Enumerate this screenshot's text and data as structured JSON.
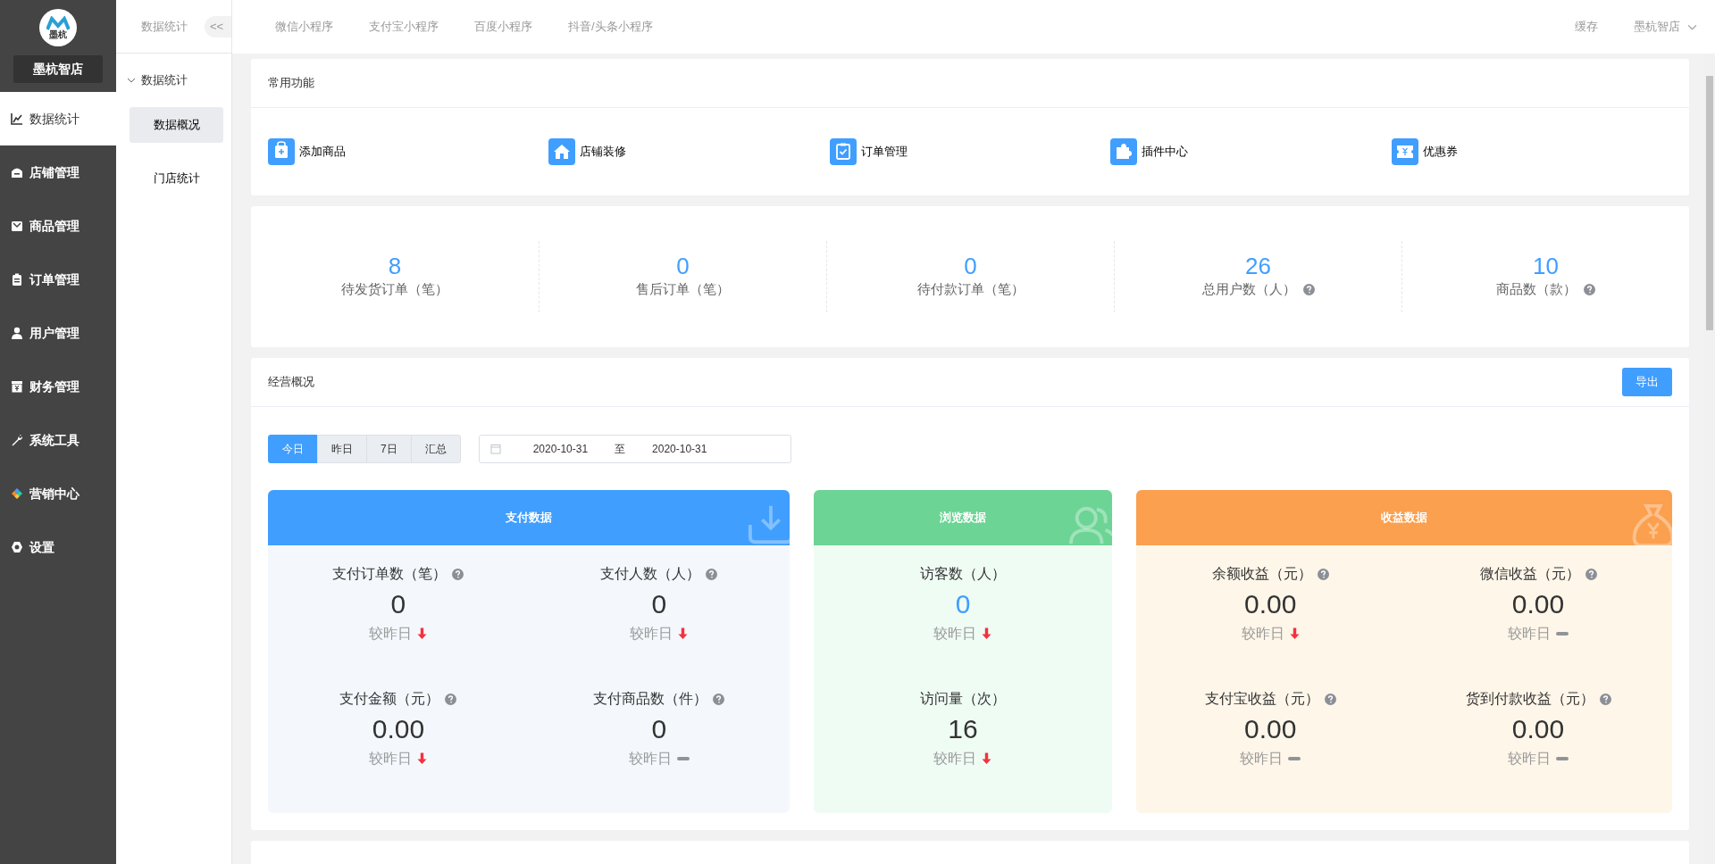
{
  "logo": {
    "caption": "墨杭"
  },
  "store_name": "墨杭智店",
  "main_menu": [
    {
      "label": "数据统计",
      "selected": true
    },
    {
      "label": "店铺管理",
      "selected": false
    },
    {
      "label": "商品管理",
      "selected": false
    },
    {
      "label": "订单管理",
      "selected": false
    },
    {
      "label": "用户管理",
      "selected": false
    },
    {
      "label": "财务管理",
      "selected": false
    },
    {
      "label": "系统工具",
      "selected": false
    },
    {
      "label": "营销中心",
      "selected": false
    },
    {
      "label": "设置",
      "selected": false
    }
  ],
  "sub_nav": {
    "title": "数据统计",
    "collapse": "<<",
    "group": {
      "label": "数据统计",
      "expanded": true,
      "items": [
        {
          "label": "数据概况",
          "selected": true
        },
        {
          "label": "门店统计",
          "selected": false
        }
      ]
    }
  },
  "top_tabs": [
    "微信小程序",
    "支付宝小程序",
    "百度小程序",
    "抖音/头条小程序"
  ],
  "top_right": {
    "cache": "缓存",
    "account": "墨杭智店"
  },
  "quick_functions": {
    "title": "常用功能",
    "items": [
      {
        "label": "添加商品"
      },
      {
        "label": "店铺装修"
      },
      {
        "label": "订单管理"
      },
      {
        "label": "插件中心"
      },
      {
        "label": "优惠券"
      }
    ]
  },
  "stats": [
    {
      "value": "8",
      "label": "待发货订单（笔）",
      "help": false
    },
    {
      "value": "0",
      "label": "售后订单（笔）",
      "help": false
    },
    {
      "value": "0",
      "label": "待付款订单（笔）",
      "help": false
    },
    {
      "value": "26",
      "label": "总用户数（人）",
      "help": true
    },
    {
      "value": "10",
      "label": "商品数（款）",
      "help": true
    }
  ],
  "overview": {
    "title": "经营概况",
    "export": "导出",
    "ranges": [
      {
        "label": "今日",
        "selected": true
      },
      {
        "label": "昨日",
        "selected": false
      },
      {
        "label": "7日",
        "selected": false
      },
      {
        "label": "汇总",
        "selected": false
      }
    ],
    "date_from": "2020-10-31",
    "date_sep": "至",
    "date_to": "2020-10-31",
    "panels": [
      {
        "title": "支付数据",
        "kind": "pay",
        "metrics": [
          {
            "label": "支付订单数（笔）",
            "help": true,
            "value": "0",
            "highlight": false,
            "compare": "较昨日",
            "decreased": true
          },
          {
            "label": "支付人数（人）",
            "help": true,
            "value": "0",
            "highlight": false,
            "compare": "较昨日",
            "decreased": true
          },
          {
            "label": "支付金额（元）",
            "help": true,
            "value": "0.00",
            "highlight": false,
            "compare": "较昨日",
            "decreased": true
          },
          {
            "label": "支付商品数（件）",
            "help": true,
            "value": "0",
            "highlight": false,
            "compare": "较昨日",
            "decreased": false
          }
        ]
      },
      {
        "title": "浏览数据",
        "kind": "browse",
        "metrics": [
          {
            "label": "访客数（人）",
            "help": false,
            "value": "0",
            "highlight": true,
            "compare": "较昨日",
            "decreased": true
          },
          {
            "label": "访问量（次）",
            "help": false,
            "value": "16",
            "highlight": false,
            "compare": "较昨日",
            "decreased": true
          }
        ]
      },
      {
        "title": "收益数据",
        "kind": "income",
        "metrics": [
          {
            "label": "余额收益（元）",
            "help": true,
            "value": "0.00",
            "highlight": false,
            "compare": "较昨日",
            "decreased": true
          },
          {
            "label": "微信收益（元）",
            "help": true,
            "value": "0.00",
            "highlight": false,
            "compare": "较昨日",
            "decreased": false
          },
          {
            "label": "支付宝收益（元）",
            "help": true,
            "value": "0.00",
            "highlight": false,
            "compare": "较昨日",
            "decreased": false
          },
          {
            "label": "货到付款收益（元）",
            "help": true,
            "value": "0.00",
            "highlight": false,
            "compare": "较昨日",
            "decreased": false
          }
        ]
      }
    ]
  }
}
